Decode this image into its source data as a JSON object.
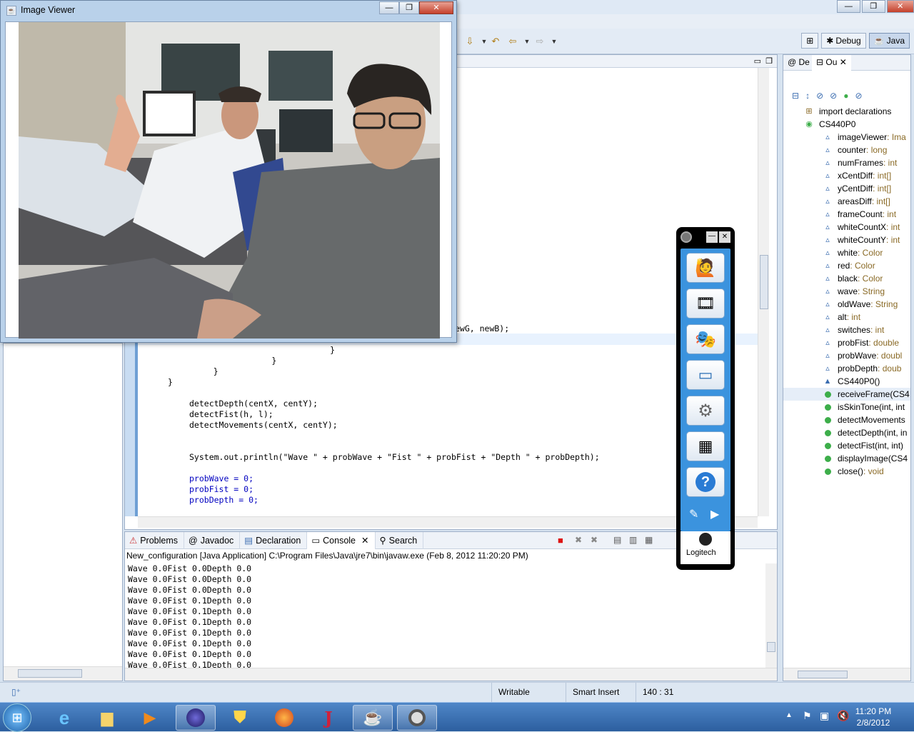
{
  "eclipse": {
    "window_controls": [
      "—",
      "❐",
      "✕"
    ],
    "perspectives": [
      "Debug",
      "Java"
    ]
  },
  "editor": {
    "code_fragment": "ewG, newB);",
    "code_lines": [
      "            }",
      "        }",
      "    }",
      "}",
      "",
      "detectDepth(centX, centY);",
      "detectFist(h, l);",
      "detectMovements(centX, centY);",
      "",
      "",
      "System.out.println(\"Wave \" + probWave + \"Fist \" + probFist + \"Depth \" + probDepth);",
      "",
      "probWave = 0;",
      "probFist = 0;",
      "probDepth = 0;"
    ]
  },
  "outline": {
    "tabs": [
      "De",
      "Ou"
    ],
    "items": [
      {
        "name": "import declarations",
        "type": "",
        "kind": "import"
      },
      {
        "name": "CS440P0",
        "type": "",
        "kind": "class"
      },
      {
        "name": "imageViewer",
        "type": " : Ima",
        "kind": "field"
      },
      {
        "name": "counter",
        "type": " : long",
        "kind": "field"
      },
      {
        "name": "numFrames",
        "type": " : int",
        "kind": "field"
      },
      {
        "name": "xCentDiff",
        "type": " : int[]",
        "kind": "field"
      },
      {
        "name": "yCentDiff",
        "type": " : int[]",
        "kind": "field"
      },
      {
        "name": "areasDiff",
        "type": " : int[]",
        "kind": "field"
      },
      {
        "name": "frameCount",
        "type": " : int",
        "kind": "field"
      },
      {
        "name": "whiteCountX",
        "type": " : int",
        "kind": "field"
      },
      {
        "name": "whiteCountY",
        "type": " : int",
        "kind": "field"
      },
      {
        "name": "white",
        "type": " : Color",
        "kind": "field"
      },
      {
        "name": "red",
        "type": " : Color",
        "kind": "field"
      },
      {
        "name": "black",
        "type": " : Color",
        "kind": "field"
      },
      {
        "name": "wave",
        "type": " : String",
        "kind": "field"
      },
      {
        "name": "oldWave",
        "type": " : String",
        "kind": "field"
      },
      {
        "name": "alt",
        "type": " : int",
        "kind": "field"
      },
      {
        "name": "switches",
        "type": " : int",
        "kind": "field"
      },
      {
        "name": "probFist",
        "type": " : double",
        "kind": "field"
      },
      {
        "name": "probWave",
        "type": " : doubl",
        "kind": "field"
      },
      {
        "name": "probDepth",
        "type": " : doub",
        "kind": "field"
      },
      {
        "name": "CS440P0()",
        "type": "",
        "kind": "ctor"
      },
      {
        "name": "receiveFrame(CS4",
        "type": "",
        "kind": "method-sel"
      },
      {
        "name": "isSkinTone(int, int",
        "type": "",
        "kind": "method"
      },
      {
        "name": "detectMovements",
        "type": "",
        "kind": "method"
      },
      {
        "name": "detectDepth(int, in",
        "type": "",
        "kind": "method"
      },
      {
        "name": "detectFist(int, int)",
        "type": "",
        "kind": "method"
      },
      {
        "name": "displayImage(CS4",
        "type": "",
        "kind": "method"
      },
      {
        "name": "close()",
        "type": " : void",
        "kind": "method"
      }
    ]
  },
  "console": {
    "tabs": [
      "Problems",
      "Javadoc",
      "Declaration",
      "Console",
      "Search"
    ],
    "description": "New_configuration [Java Application] C:\\Program Files\\Java\\jre7\\bin\\javaw.exe (Feb 8, 2012 11:20:20 PM)",
    "lines": [
      "Wave 0.0Fist 0.0Depth 0.0",
      "Wave 0.0Fist 0.0Depth 0.0",
      "Wave 0.0Fist 0.0Depth 0.0",
      "Wave 0.0Fist 0.1Depth 0.0",
      "Wave 0.0Fist 0.1Depth 0.0",
      "Wave 0.0Fist 0.1Depth 0.0",
      "Wave 0.0Fist 0.1Depth 0.0",
      "Wave 0.0Fist 0.1Depth 0.0",
      "Wave 0.0Fist 0.1Depth 0.0",
      "Wave 0.0Fist 0.1Depth 0.0"
    ]
  },
  "status": {
    "writable": "Writable",
    "insert_mode": "Smart Insert",
    "position": "140 : 31"
  },
  "image_viewer": {
    "title": "Image Viewer"
  },
  "logitech": {
    "brand": "Logitech"
  },
  "taskbar": {
    "time": "11:20 PM",
    "date": "2/8/2012"
  }
}
